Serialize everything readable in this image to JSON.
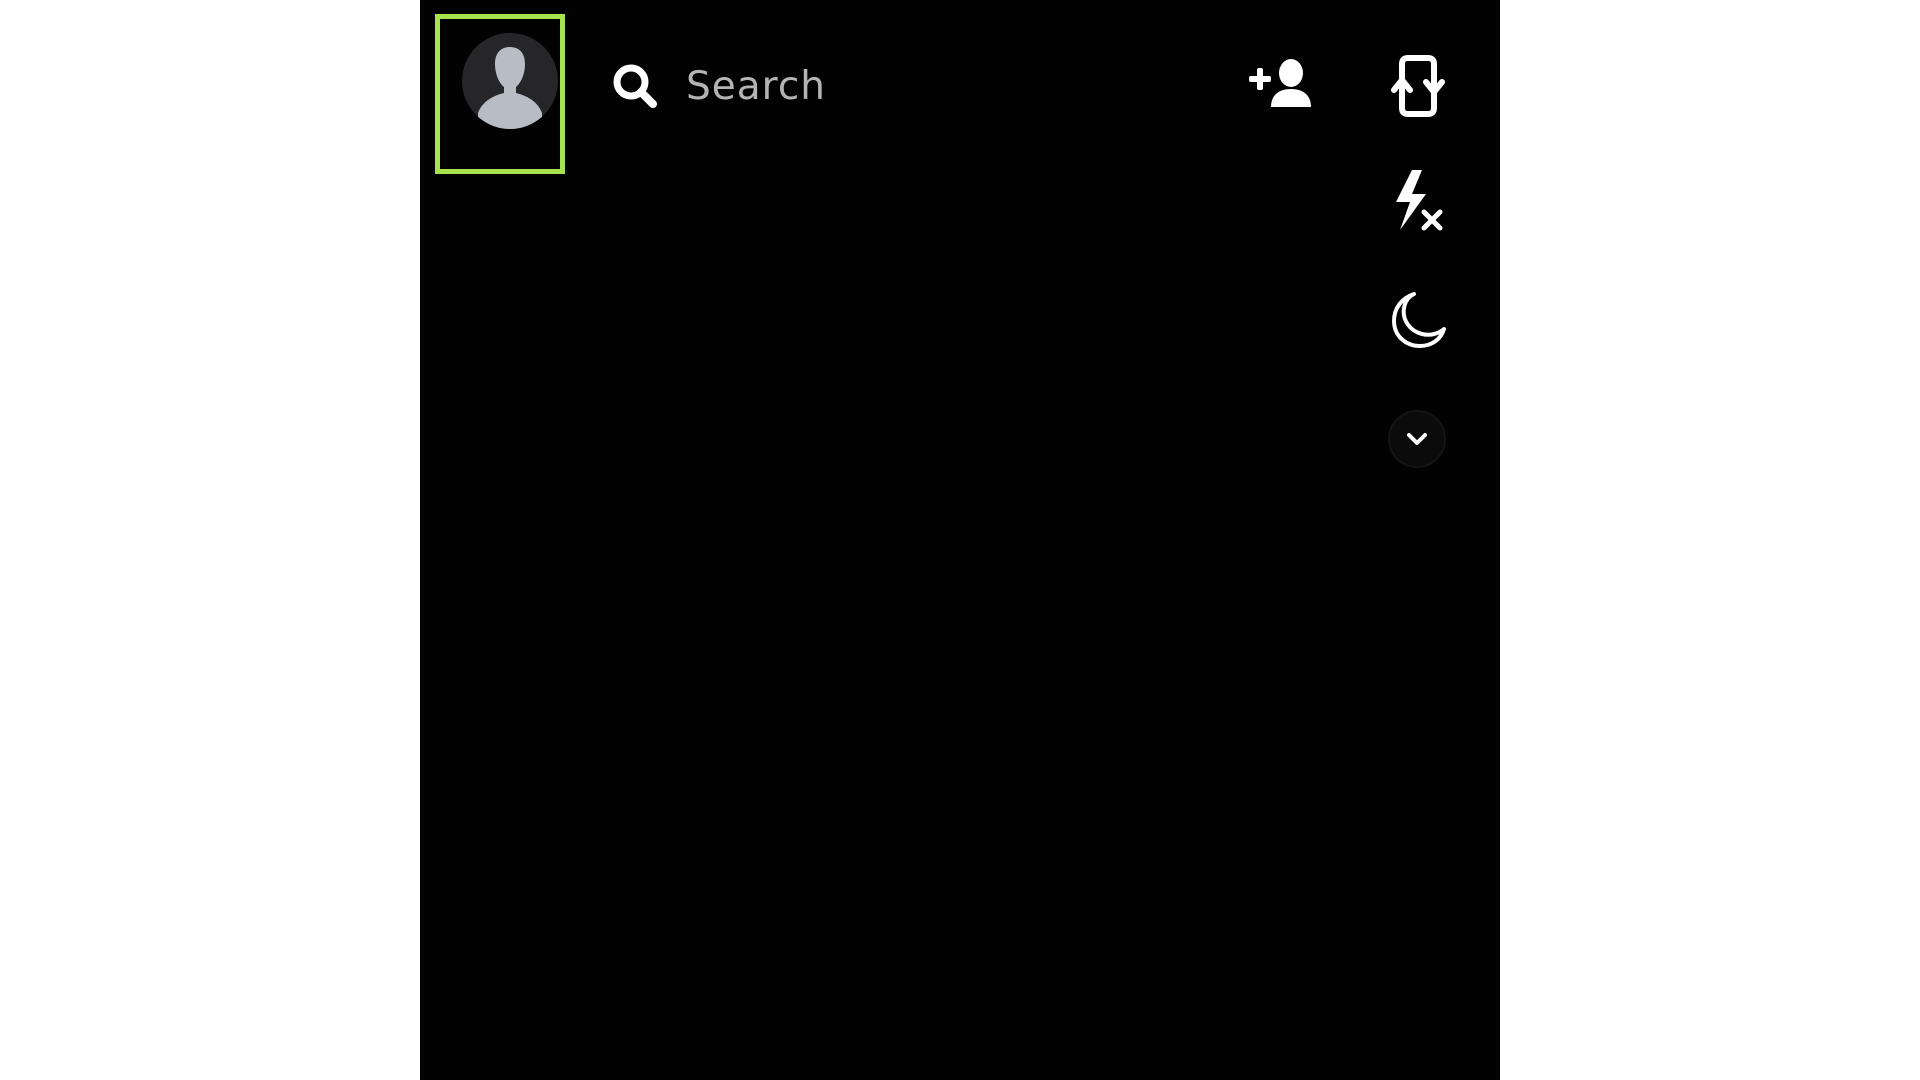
{
  "search": {
    "placeholder": "Search"
  },
  "icons": {
    "avatar": "avatar-icon",
    "search": "search-icon",
    "add_friend": "add-friend-icon",
    "flip_camera": "flip-camera-icon",
    "flash_off": "flash-off-icon",
    "night_mode": "night-mode-icon",
    "more": "chevron-down-icon"
  },
  "colors": {
    "background": "#020202",
    "highlight": "#a6e34d",
    "icon": "#ffffff",
    "placeholder_text": "#b4b4b4",
    "avatar_bg": "#262629",
    "avatar_figure": "#b8bcc4"
  }
}
